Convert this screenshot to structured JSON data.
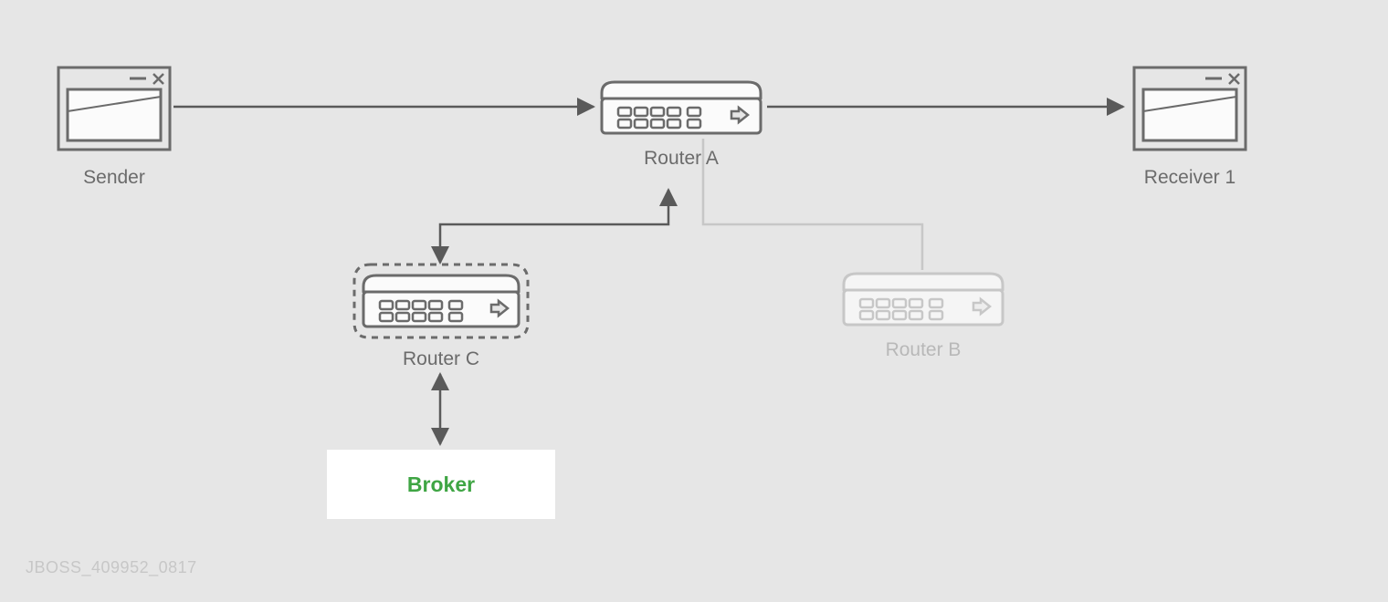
{
  "nodes": {
    "sender": {
      "label": "Sender"
    },
    "routerA": {
      "label": "Router A"
    },
    "routerB": {
      "label": "Router B"
    },
    "routerC": {
      "label": "Router C"
    },
    "receiver1": {
      "label": "Receiver 1"
    },
    "broker": {
      "label": "Broker"
    }
  },
  "footer": "JBOSS_409952_0817",
  "colors": {
    "line_dark": "#5a5a5a",
    "line_faded": "#c7c7c7",
    "text": "#6b6b6b",
    "text_faded": "#b8b8b8",
    "broker_green": "#3fa544",
    "bg": "#e6e6e6"
  }
}
